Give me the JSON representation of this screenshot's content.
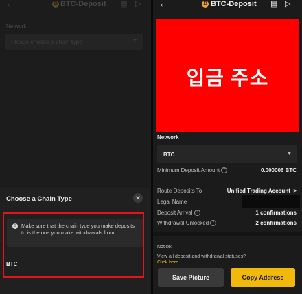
{
  "colors": {
    "accent": "#f0b90b",
    "highlight_red": "#e5141a",
    "address_block": "#ff0000"
  },
  "header": {
    "title": "BTC-Deposit",
    "coin_symbol": "₿",
    "back_icon": "←",
    "history_icon": "▤",
    "play_icon": "▷"
  },
  "left": {
    "network_label": "Network",
    "select_placeholder": "Please choose a chain type",
    "sheet": {
      "title": "Choose a Chain Type",
      "close_icon": "✕",
      "notice": "Make sure that the chain type you make deposits to is the one you make withdrawals from.",
      "info_icon": "!",
      "option": "BTC"
    }
  },
  "right": {
    "address_image_text": "입금 주소",
    "network_label": "Network",
    "network_value": "BTC",
    "dropdown_icon": "▼",
    "rows": {
      "min_deposit": {
        "label": "Minimum Deposit Amount",
        "value": "0.000006 BTC"
      },
      "route": {
        "label": "Route Deposits To",
        "value": "Unified Trading Account",
        "chevron": ">"
      },
      "legal_name": {
        "label": "Legal Name"
      },
      "deposit_arrival": {
        "label": "Deposit Arrival",
        "value": "1 confirmations"
      },
      "withdrawal_unlocked": {
        "label": "Withdrawal Unlocked",
        "value": "2 confirmations"
      }
    },
    "notice_label": "Notice:",
    "notice_text": "View all deposit and withdrawal statuses?",
    "click_here": "Click here",
    "save_button": "Save Picture",
    "copy_button": "Copy Address"
  }
}
